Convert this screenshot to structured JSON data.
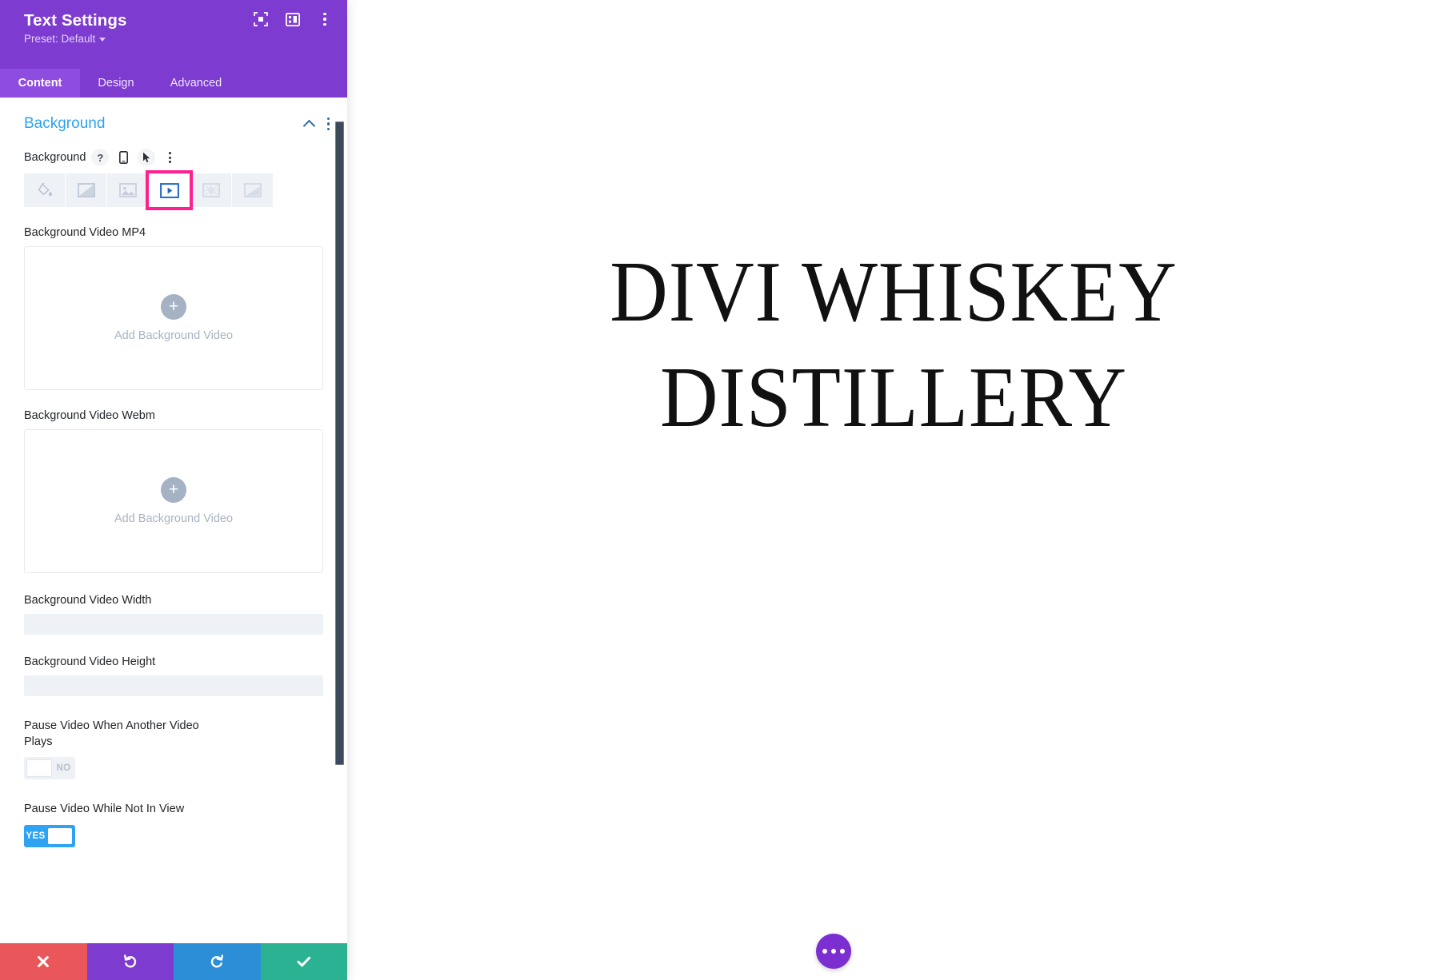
{
  "panel": {
    "title": "Text Settings",
    "preset_label": "Preset: Default",
    "header_icons": [
      {
        "name": "focus-icon"
      },
      {
        "name": "layout-panel-icon"
      },
      {
        "name": "more-options-icon"
      }
    ],
    "tabs": [
      {
        "label": "Content",
        "active": true
      },
      {
        "label": "Design",
        "active": false
      },
      {
        "label": "Advanced",
        "active": false
      }
    ],
    "section": {
      "title": "Background",
      "collapse_icon": "chevron-up-icon",
      "options_icon": "more-options-icon"
    },
    "background_field": {
      "label": "Background",
      "help_icon": "question-mark-icon",
      "responsive_icon": "mobile-device-icon",
      "hover_icon": "cursor-pointer-icon",
      "options_icon": "more-options-icon",
      "types": [
        {
          "name": "background-color",
          "icon": "paint-bucket-icon",
          "selected": false
        },
        {
          "name": "background-gradient",
          "icon": "gradient-icon",
          "selected": false
        },
        {
          "name": "background-image",
          "icon": "image-icon",
          "selected": false
        },
        {
          "name": "background-video",
          "icon": "video-play-icon",
          "selected": true
        },
        {
          "name": "background-pattern",
          "icon": "pattern-icon",
          "selected": false
        },
        {
          "name": "background-mask",
          "icon": "mask-icon",
          "selected": false
        }
      ]
    },
    "fields": {
      "video_mp4_label": "Background Video MP4",
      "video_mp4_cta": "Add Background Video",
      "video_webm_label": "Background Video Webm",
      "video_webm_cta": "Add Background Video",
      "video_width_label": "Background Video Width",
      "video_width_value": "",
      "video_width_placeholder": "",
      "video_height_label": "Background Video Height",
      "video_height_value": "",
      "video_height_placeholder": "",
      "pause_other_label": "Pause Video When Another Video Plays",
      "pause_other_state": "NO",
      "pause_not_in_view_label": "Pause Video While Not In View",
      "pause_not_in_view_state": "YES"
    },
    "footer": [
      {
        "name": "cancel-button",
        "icon": "close-icon",
        "color": "#e9575a"
      },
      {
        "name": "undo-button",
        "icon": "undo-arrow-icon",
        "color": "#7e3bd0"
      },
      {
        "name": "redo-button",
        "icon": "redo-arrow-icon",
        "color": "#2b8ed6"
      },
      {
        "name": "save-button",
        "icon": "checkmark-icon",
        "color": "#2bb292"
      }
    ]
  },
  "canvas": {
    "heading_line1": "DIVI WHISKEY",
    "heading_line2": "DISTILLERY",
    "fab_icon": "ellipsis-icon"
  },
  "colors": {
    "panel_purple": "#7e3bd0",
    "tab_active_purple": "#8f4ce0",
    "section_blue": "#2ea3f2",
    "highlight_pink": "#ff1f8e",
    "toggle_on_blue": "#2ea3f2",
    "scrollbar_dark": "#3d4a5c"
  }
}
